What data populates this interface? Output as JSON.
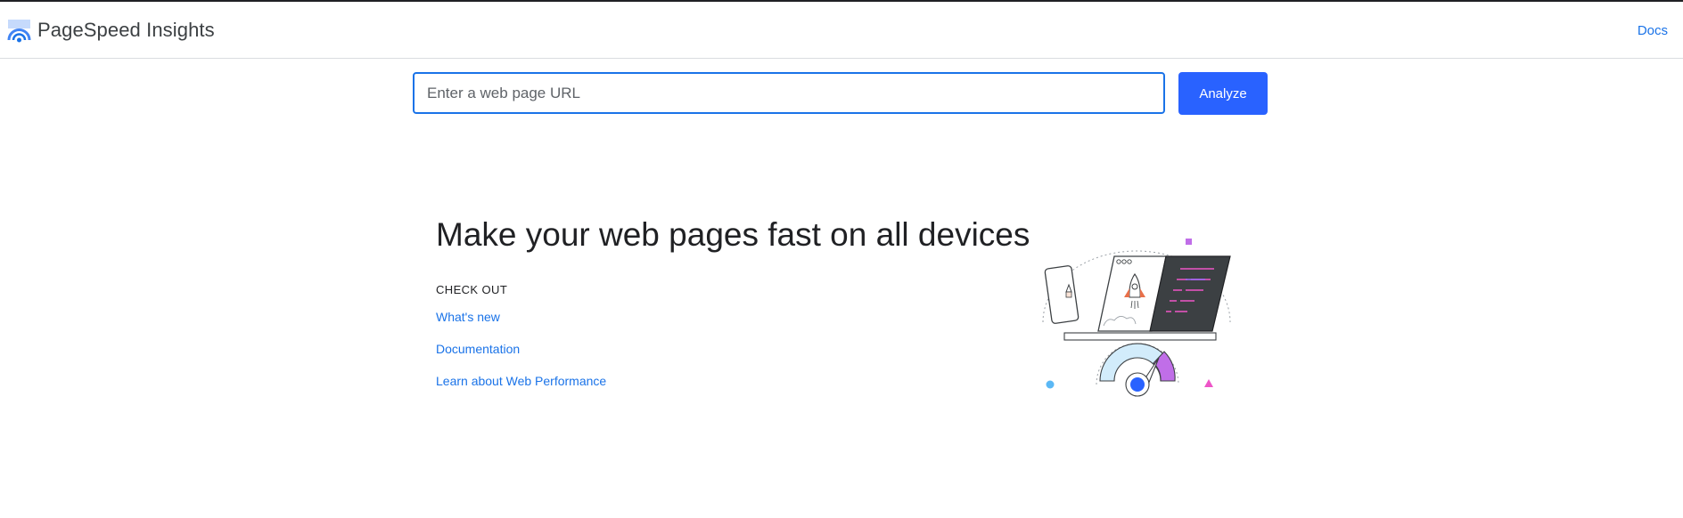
{
  "header": {
    "app_title": "PageSpeed Insights",
    "docs_label": "Docs"
  },
  "search": {
    "placeholder": "Enter a web page URL",
    "value": "",
    "analyze_label": "Analyze"
  },
  "hero": {
    "title": "Make your web pages fast on all devices",
    "check_out_label": "CHECK OUT",
    "links": [
      {
        "label": "What's new"
      },
      {
        "label": "Documentation"
      },
      {
        "label": "Learn about Web Performance"
      }
    ]
  },
  "colors": {
    "accent": "#1a73e8",
    "button": "#2962ff",
    "text": "#202124"
  },
  "icons": {
    "logo": "pagespeed-logo-icon",
    "illustration": "speed-rocket-illustration"
  }
}
